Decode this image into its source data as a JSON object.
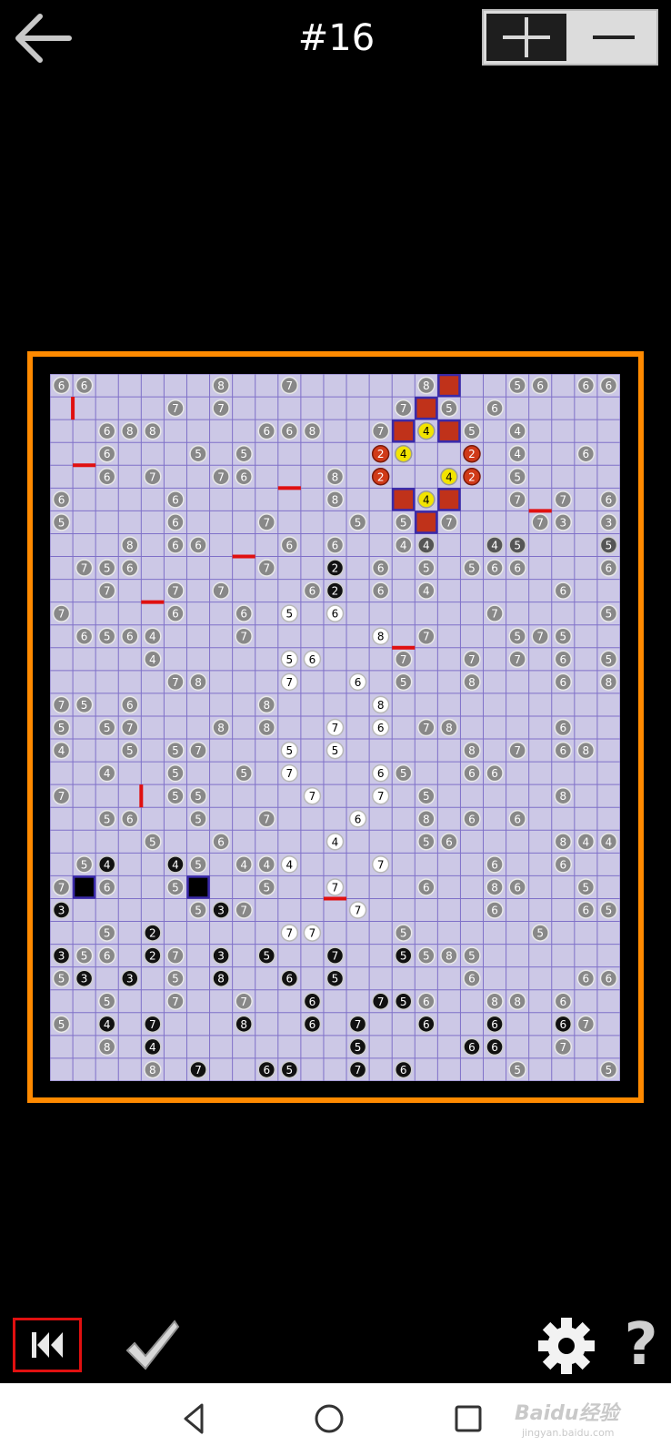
{
  "header": {
    "title": "#16",
    "back_icon": "back-arrow-icon",
    "zoom_in_icon": "plus-icon",
    "zoom_out_icon": "minus-icon"
  },
  "colors": {
    "board_bg": "#ccc8e6",
    "grid_line": "#7f70c8",
    "frame": "#ff8a00",
    "wall": "#e01010",
    "block_red": "#c0321a",
    "block_border": "#3a2aa8",
    "gray_clue": "#888888",
    "black_clue": "#111111",
    "white_clue": "#ffffff",
    "yellow_clue": "#f2e400",
    "red_clue": "#d03a18",
    "dark_clue": "#555555"
  },
  "board": {
    "cols": 25,
    "rows": 31,
    "gray": [
      [
        0,
        0,
        6
      ],
      [
        1,
        0,
        6
      ],
      [
        7,
        0,
        8
      ],
      [
        10,
        0,
        7
      ],
      [
        16,
        0,
        8
      ],
      [
        20,
        0,
        5
      ],
      [
        21,
        0,
        6
      ],
      [
        23,
        0,
        6
      ],
      [
        24,
        0,
        6
      ],
      [
        5,
        1,
        7
      ],
      [
        7,
        1,
        7
      ],
      [
        15,
        1,
        7
      ],
      [
        17,
        1,
        5
      ],
      [
        19,
        1,
        6
      ],
      [
        2,
        2,
        6
      ],
      [
        3,
        2,
        8
      ],
      [
        4,
        2,
        8
      ],
      [
        9,
        2,
        6
      ],
      [
        10,
        2,
        6
      ],
      [
        11,
        2,
        8
      ],
      [
        14,
        2,
        7
      ],
      [
        18,
        2,
        5
      ],
      [
        20,
        2,
        4
      ],
      [
        2,
        3,
        6
      ],
      [
        6,
        3,
        5
      ],
      [
        8,
        3,
        5
      ],
      [
        20,
        3,
        4
      ],
      [
        23,
        3,
        6
      ],
      [
        2,
        4,
        6
      ],
      [
        4,
        4,
        7
      ],
      [
        7,
        4,
        7
      ],
      [
        8,
        4,
        6
      ],
      [
        12,
        4,
        8
      ],
      [
        20,
        4,
        5
      ],
      [
        0,
        5,
        6
      ],
      [
        5,
        5,
        6
      ],
      [
        12,
        5,
        8
      ],
      [
        20,
        5,
        7
      ],
      [
        22,
        5,
        7
      ],
      [
        24,
        5,
        6
      ],
      [
        0,
        6,
        5
      ],
      [
        5,
        6,
        6
      ],
      [
        9,
        6,
        7
      ],
      [
        13,
        6,
        5
      ],
      [
        15,
        6,
        5
      ],
      [
        17,
        6,
        7
      ],
      [
        21,
        6,
        7
      ],
      [
        22,
        6,
        3
      ],
      [
        24,
        6,
        3
      ],
      [
        3,
        7,
        8
      ],
      [
        5,
        7,
        6
      ],
      [
        6,
        7,
        6
      ],
      [
        10,
        7,
        6
      ],
      [
        12,
        7,
        6
      ],
      [
        15,
        7,
        4
      ],
      [
        1,
        8,
        7
      ],
      [
        2,
        8,
        5
      ],
      [
        3,
        8,
        6
      ],
      [
        9,
        8,
        7
      ],
      [
        14,
        8,
        6
      ],
      [
        16,
        8,
        5
      ],
      [
        18,
        8,
        5
      ],
      [
        19,
        8,
        6
      ],
      [
        20,
        8,
        6
      ],
      [
        24,
        8,
        6
      ],
      [
        2,
        9,
        7
      ],
      [
        5,
        9,
        7
      ],
      [
        7,
        9,
        7
      ],
      [
        11,
        9,
        6
      ],
      [
        14,
        9,
        6
      ],
      [
        16,
        9,
        4
      ],
      [
        22,
        9,
        6
      ],
      [
        0,
        10,
        7
      ],
      [
        5,
        10,
        6
      ],
      [
        8,
        10,
        6
      ],
      [
        19,
        10,
        7
      ],
      [
        24,
        10,
        5
      ],
      [
        1,
        11,
        6
      ],
      [
        2,
        11,
        5
      ],
      [
        3,
        11,
        6
      ],
      [
        4,
        11,
        4
      ],
      [
        8,
        11,
        7
      ],
      [
        16,
        11,
        7
      ],
      [
        20,
        11,
        5
      ],
      [
        21,
        11,
        7
      ],
      [
        22,
        11,
        5
      ],
      [
        4,
        12,
        4
      ],
      [
        15,
        12,
        7
      ],
      [
        18,
        12,
        7
      ],
      [
        20,
        12,
        7
      ],
      [
        22,
        12,
        6
      ],
      [
        24,
        12,
        5
      ],
      [
        5,
        13,
        7
      ],
      [
        6,
        13,
        8
      ],
      [
        15,
        13,
        5
      ],
      [
        18,
        13,
        8
      ],
      [
        22,
        13,
        6
      ],
      [
        24,
        13,
        8
      ],
      [
        0,
        14,
        7
      ],
      [
        1,
        14,
        5
      ],
      [
        3,
        14,
        6
      ],
      [
        9,
        14,
        8
      ],
      [
        0,
        15,
        5
      ],
      [
        2,
        15,
        5
      ],
      [
        3,
        15,
        7
      ],
      [
        7,
        15,
        8
      ],
      [
        9,
        15,
        8
      ],
      [
        16,
        15,
        7
      ],
      [
        17,
        15,
        8
      ],
      [
        22,
        15,
        6
      ],
      [
        0,
        16,
        4
      ],
      [
        3,
        16,
        5
      ],
      [
        5,
        16,
        5
      ],
      [
        6,
        16,
        7
      ],
      [
        18,
        16,
        8
      ],
      [
        20,
        16,
        7
      ],
      [
        22,
        16,
        6
      ],
      [
        23,
        16,
        8
      ],
      [
        2,
        17,
        4
      ],
      [
        5,
        17,
        5
      ],
      [
        8,
        17,
        5
      ],
      [
        15,
        17,
        5
      ],
      [
        18,
        17,
        6
      ],
      [
        19,
        17,
        6
      ],
      [
        0,
        18,
        7
      ],
      [
        5,
        18,
        5
      ],
      [
        6,
        18,
        5
      ],
      [
        16,
        18,
        5
      ],
      [
        22,
        18,
        8
      ],
      [
        2,
        19,
        5
      ],
      [
        3,
        19,
        6
      ],
      [
        6,
        19,
        5
      ],
      [
        9,
        19,
        7
      ],
      [
        16,
        19,
        8
      ],
      [
        18,
        19,
        6
      ],
      [
        20,
        19,
        6
      ],
      [
        4,
        20,
        5
      ],
      [
        7,
        20,
        6
      ],
      [
        16,
        20,
        5
      ],
      [
        17,
        20,
        6
      ],
      [
        22,
        20,
        8
      ],
      [
        23,
        20,
        4
      ],
      [
        24,
        20,
        4
      ],
      [
        1,
        21,
        5
      ],
      [
        6,
        21,
        5
      ],
      [
        8,
        21,
        4
      ],
      [
        9,
        21,
        4
      ],
      [
        19,
        21,
        6
      ],
      [
        22,
        21,
        6
      ],
      [
        0,
        22,
        7
      ],
      [
        2,
        22,
        6
      ],
      [
        5,
        22,
        5
      ],
      [
        9,
        22,
        5
      ],
      [
        16,
        22,
        6
      ],
      [
        19,
        22,
        8
      ],
      [
        20,
        22,
        6
      ],
      [
        23,
        22,
        5
      ],
      [
        6,
        23,
        5
      ],
      [
        8,
        23,
        7
      ],
      [
        19,
        23,
        6
      ],
      [
        23,
        23,
        6
      ],
      [
        24,
        23,
        5
      ],
      [
        2,
        24,
        5
      ],
      [
        15,
        24,
        5
      ],
      [
        21,
        24,
        5
      ],
      [
        1,
        25,
        5
      ],
      [
        2,
        25,
        6
      ],
      [
        5,
        25,
        7
      ],
      [
        16,
        25,
        5
      ],
      [
        17,
        25,
        8
      ],
      [
        18,
        25,
        5
      ],
      [
        0,
        26,
        5
      ],
      [
        5,
        26,
        5
      ],
      [
        18,
        26,
        6
      ],
      [
        23,
        26,
        6
      ],
      [
        24,
        26,
        6
      ],
      [
        2,
        27,
        5
      ],
      [
        5,
        27,
        7
      ],
      [
        8,
        27,
        7
      ],
      [
        16,
        27,
        6
      ],
      [
        19,
        27,
        8
      ],
      [
        20,
        27,
        8
      ],
      [
        22,
        27,
        6
      ],
      [
        0,
        28,
        5
      ],
      [
        23,
        28,
        7
      ],
      [
        2,
        29,
        8
      ],
      [
        22,
        29,
        7
      ],
      [
        4,
        30,
        8
      ],
      [
        20,
        30,
        5
      ],
      [
        24,
        30,
        5
      ]
    ],
    "black": [
      [
        12,
        8,
        2
      ],
      [
        12,
        9,
        2
      ],
      [
        2,
        21,
        4
      ],
      [
        5,
        21,
        4
      ],
      [
        0,
        23,
        3
      ],
      [
        7,
        23,
        3
      ],
      [
        4,
        24,
        2
      ],
      [
        0,
        25,
        3
      ],
      [
        4,
        25,
        2
      ],
      [
        7,
        25,
        3
      ],
      [
        9,
        25,
        5
      ],
      [
        12,
        25,
        7
      ],
      [
        15,
        25,
        5
      ],
      [
        1,
        26,
        3
      ],
      [
        3,
        26,
        3
      ],
      [
        7,
        26,
        8
      ],
      [
        10,
        26,
        6
      ],
      [
        12,
        26,
        5
      ],
      [
        11,
        27,
        6
      ],
      [
        14,
        27,
        7
      ],
      [
        15,
        27,
        5
      ],
      [
        2,
        28,
        4
      ],
      [
        4,
        28,
        7
      ],
      [
        8,
        28,
        8
      ],
      [
        11,
        28,
        6
      ],
      [
        13,
        28,
        7
      ],
      [
        16,
        28,
        6
      ],
      [
        19,
        28,
        6
      ],
      [
        22,
        28,
        6
      ],
      [
        4,
        29,
        4
      ],
      [
        13,
        29,
        5
      ],
      [
        18,
        29,
        6
      ],
      [
        19,
        29,
        6
      ],
      [
        6,
        30,
        7
      ],
      [
        9,
        30,
        6
      ],
      [
        10,
        30,
        5
      ],
      [
        13,
        30,
        7
      ],
      [
        15,
        30,
        6
      ]
    ],
    "white": [
      [
        10,
        10,
        5
      ],
      [
        12,
        10,
        6
      ],
      [
        14,
        11,
        8
      ],
      [
        10,
        12,
        5
      ],
      [
        11,
        12,
        6
      ],
      [
        10,
        13,
        7
      ],
      [
        13,
        13,
        6
      ],
      [
        14,
        14,
        8
      ],
      [
        12,
        15,
        7
      ],
      [
        14,
        15,
        6
      ],
      [
        10,
        16,
        5
      ],
      [
        12,
        16,
        5
      ],
      [
        10,
        17,
        7
      ],
      [
        14,
        17,
        6
      ],
      [
        11,
        18,
        7
      ],
      [
        14,
        18,
        7
      ],
      [
        13,
        19,
        6
      ],
      [
        12,
        20,
        4
      ],
      [
        10,
        21,
        4
      ],
      [
        14,
        21,
        7
      ],
      [
        12,
        22,
        7
      ],
      [
        13,
        23,
        7
      ],
      [
        10,
        24,
        7
      ],
      [
        11,
        24,
        7
      ]
    ],
    "yellow": [
      [
        16,
        2,
        4
      ],
      [
        15,
        3,
        4
      ],
      [
        17,
        4,
        4
      ],
      [
        16,
        5,
        4
      ]
    ],
    "red_circles": [
      [
        14,
        3,
        2
      ],
      [
        18,
        3,
        2
      ],
      [
        14,
        4,
        2
      ],
      [
        18,
        4,
        2
      ]
    ],
    "dark": [
      [
        16,
        7,
        4
      ],
      [
        19,
        7,
        4
      ],
      [
        20,
        7,
        5
      ],
      [
        24,
        7,
        5
      ]
    ],
    "red_blocks": [
      [
        17,
        0
      ],
      [
        16,
        1
      ],
      [
        15,
        2
      ],
      [
        17,
        2
      ],
      [
        15,
        5
      ],
      [
        17,
        5
      ],
      [
        16,
        6
      ]
    ],
    "black_blocks": [
      [
        1,
        22
      ],
      [
        6,
        22
      ]
    ],
    "walls_h": [
      [
        1,
        4
      ],
      [
        10,
        5
      ],
      [
        21,
        6
      ],
      [
        8,
        8
      ],
      [
        4,
        10
      ],
      [
        15,
        12
      ],
      [
        12,
        23
      ]
    ],
    "walls_v": [
      [
        1,
        1
      ],
      [
        4,
        18
      ]
    ]
  },
  "bottombar": {
    "rewind_icon": "rewind-icon",
    "check_icon": "checkmark-icon",
    "settings_icon": "gear-icon",
    "help_label": "?"
  },
  "navbar": {
    "back_icon": "nav-back-icon",
    "home_icon": "nav-home-icon",
    "recents_icon": "nav-recents-icon",
    "watermark_text": "Baidu经验",
    "watermark_sub": "jingyan.baidu.com"
  }
}
